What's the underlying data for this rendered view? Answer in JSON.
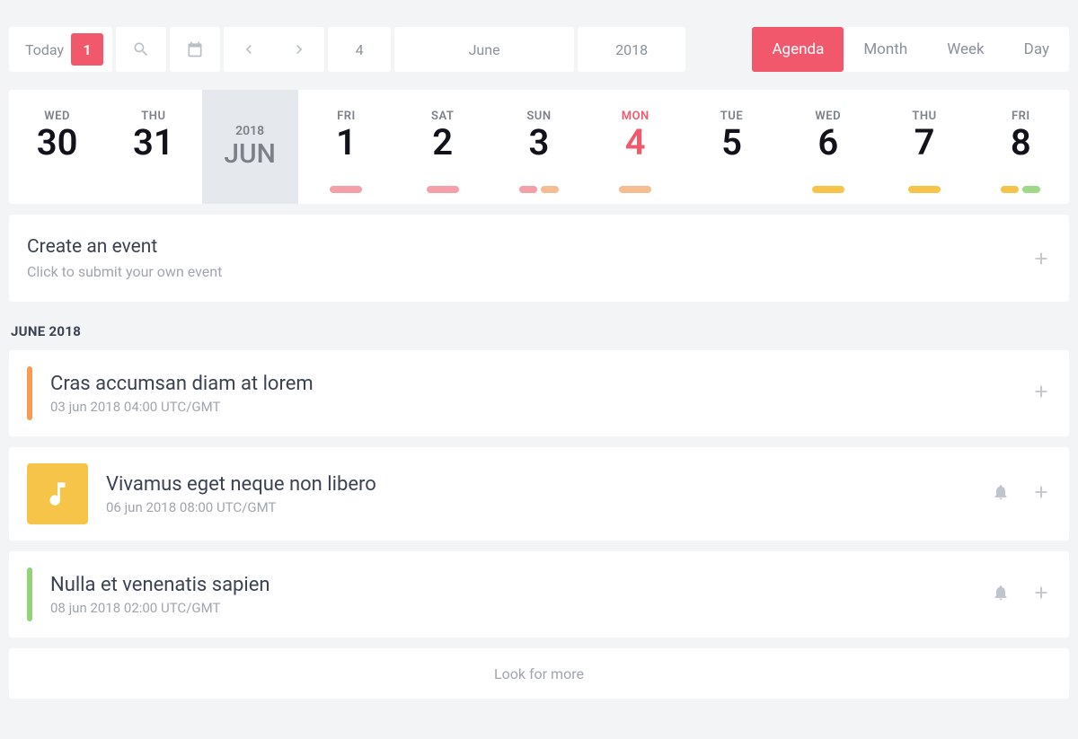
{
  "toolbar": {
    "today_label": "Today",
    "badge_count": "1",
    "date_day": "4",
    "date_month": "June",
    "date_year": "2018"
  },
  "views": [
    {
      "label": "Agenda",
      "active": true
    },
    {
      "label": "Month",
      "active": false
    },
    {
      "label": "Week",
      "active": false
    },
    {
      "label": "Day",
      "active": false
    }
  ],
  "day_strip": {
    "month_label_year": "2018",
    "month_label_mon": "JUN",
    "days": [
      {
        "dow": "WED",
        "num": "30",
        "today": false,
        "dots": []
      },
      {
        "dow": "THU",
        "num": "31",
        "today": false,
        "dots": []
      },
      {
        "month_break": true
      },
      {
        "dow": "FRI",
        "num": "1",
        "today": false,
        "dots": [
          {
            "c": "pink",
            "w": "wide"
          }
        ]
      },
      {
        "dow": "SAT",
        "num": "2",
        "today": false,
        "dots": [
          {
            "c": "pink",
            "w": "wide"
          }
        ]
      },
      {
        "dow": "SUN",
        "num": "3",
        "today": false,
        "dots": [
          {
            "c": "pink",
            "w": ""
          },
          {
            "c": "orange",
            "w": ""
          }
        ]
      },
      {
        "dow": "MON",
        "num": "4",
        "today": true,
        "dots": [
          {
            "c": "orange",
            "w": "wide"
          }
        ]
      },
      {
        "dow": "TUE",
        "num": "5",
        "today": false,
        "dots": []
      },
      {
        "dow": "WED",
        "num": "6",
        "today": false,
        "dots": [
          {
            "c": "yellow",
            "w": "wide"
          }
        ]
      },
      {
        "dow": "THU",
        "num": "7",
        "today": false,
        "dots": [
          {
            "c": "yellow",
            "w": "wide"
          }
        ]
      },
      {
        "dow": "FRI",
        "num": "8",
        "today": false,
        "dots": [
          {
            "c": "yellow",
            "w": ""
          },
          {
            "c": "green",
            "w": ""
          }
        ]
      }
    ]
  },
  "create": {
    "title": "Create an event",
    "sub": "Click to submit your own event"
  },
  "section_header": "JUNE 2018",
  "events": [
    {
      "title": "Cras accumsan diam at lorem",
      "sub": "03 jun 2018 04:00 UTC/GMT",
      "marker": {
        "type": "strip",
        "color": "orange"
      },
      "bell": false
    },
    {
      "title": "Vivamus eget neque non libero",
      "sub": "06 jun 2018 08:00 UTC/GMT",
      "marker": {
        "type": "icon",
        "color": "yellow"
      },
      "bell": true
    },
    {
      "title": "Nulla et venenatis sapien",
      "sub": "08 jun 2018 02:00 UTC/GMT",
      "marker": {
        "type": "strip",
        "color": "green"
      },
      "bell": true
    }
  ],
  "look_more": "Look for more"
}
